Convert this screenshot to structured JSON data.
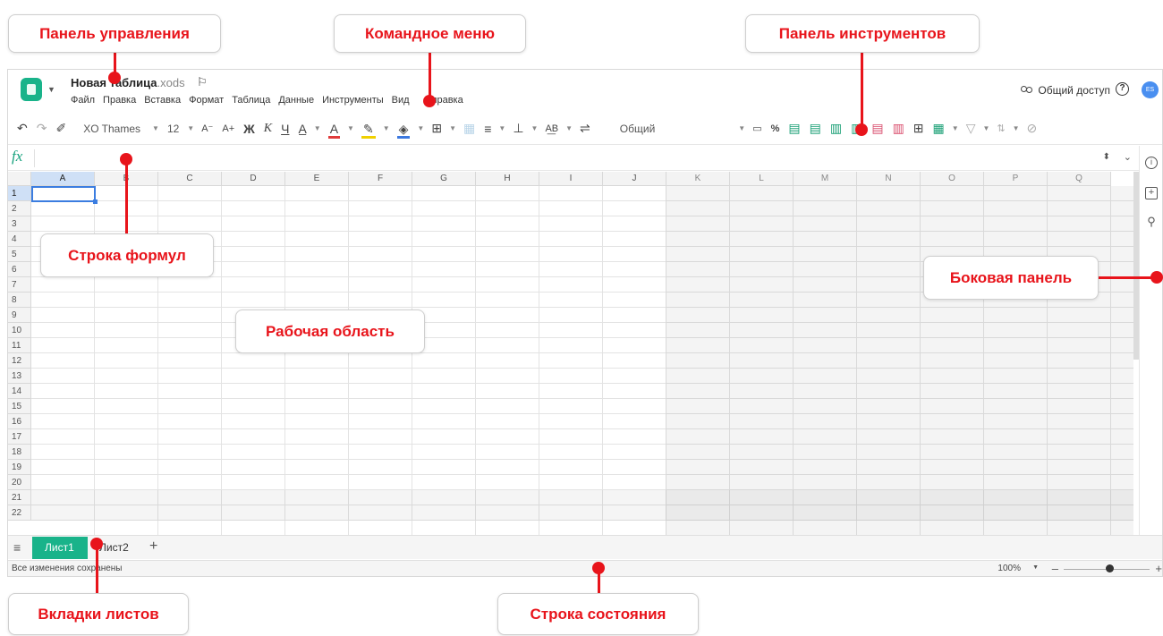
{
  "header": {
    "doc_name": "Новая таблица",
    "doc_ext": ".xods",
    "menu": [
      "Файл",
      "Правка",
      "Вставка",
      "Формат",
      "Таблица",
      "Данные",
      "Инструменты",
      "Вид",
      "Справка"
    ],
    "share_label": "Общий доступ",
    "help_label": "?",
    "avatar_initials": "ES"
  },
  "toolbar": {
    "font": "XO Thames",
    "font_size": "12",
    "decrease_font": "A⁻",
    "increase_font": "A+",
    "bold": "Ж",
    "italic": "К",
    "underline": "Ч",
    "number_format": "Общий"
  },
  "formula_bar": {
    "fx_label": "fx"
  },
  "grid": {
    "columns": [
      "A",
      "B",
      "C",
      "D",
      "E",
      "F",
      "G",
      "H",
      "I",
      "J",
      "K",
      "L",
      "M",
      "N",
      "O",
      "P",
      "Q"
    ],
    "rows": [
      "1",
      "2",
      "3",
      "4",
      "5",
      "6",
      "7",
      "8",
      "9",
      "10",
      "11",
      "12",
      "13",
      "14",
      "15",
      "16",
      "17",
      "18",
      "19",
      "20",
      "21",
      "22"
    ],
    "active_cell": "A1"
  },
  "sheet_tabs": {
    "tabs": [
      "Лист1",
      "Лист2"
    ],
    "active": "Лист1",
    "add_label": "+"
  },
  "status_bar": {
    "text": "Все изменения сохранены",
    "zoom": "100%",
    "zoom_minus": "–",
    "zoom_plus": "+",
    "zoom_level": 0.55
  },
  "annotations": {
    "control_panel": "Панель управления",
    "command_menu": "Командное меню",
    "toolbar": "Панель инструментов",
    "formula_bar": "Строка формул",
    "sidebar": "Боковая панель",
    "workspace": "Рабочая область",
    "sheet_tabs": "Вкладки листов",
    "status_bar": "Строка состояния"
  },
  "colors": {
    "annotation": "#e8141b",
    "accent": "#19b38a",
    "selection": "#3b7de0"
  }
}
